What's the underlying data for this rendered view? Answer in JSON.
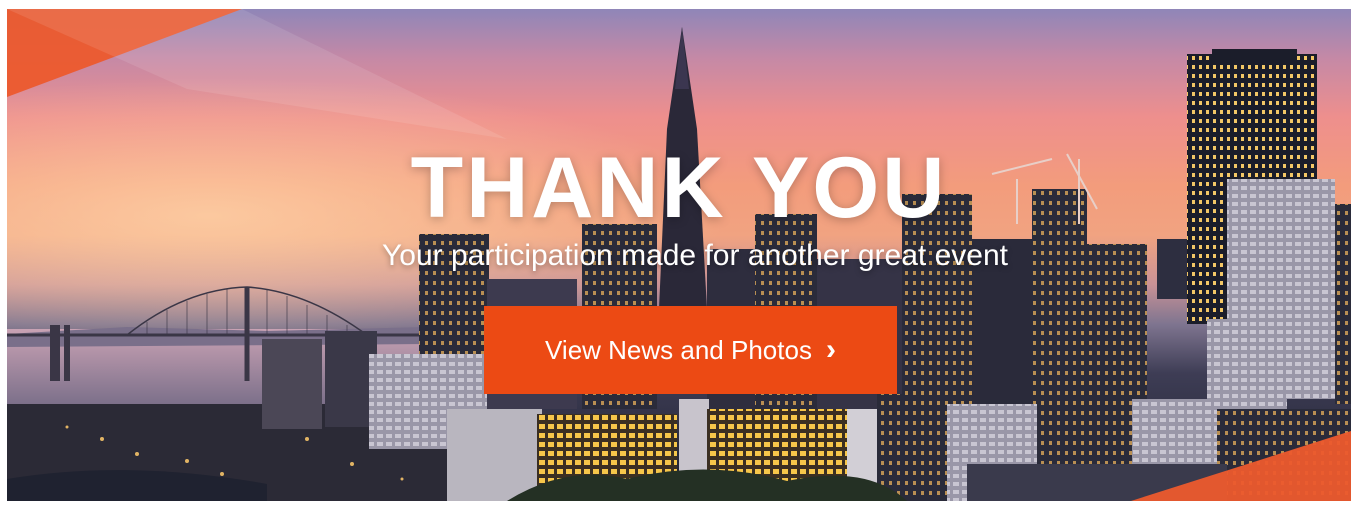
{
  "hero": {
    "headline": "THANK YOU",
    "subheadline": "Your participation made for another great event",
    "cta_label": "View News and Photos",
    "cta_icon": "chevron-right-icon",
    "cta_glyph": "›"
  },
  "colors": {
    "accent": "#ec4a14",
    "text": "#ffffff"
  }
}
